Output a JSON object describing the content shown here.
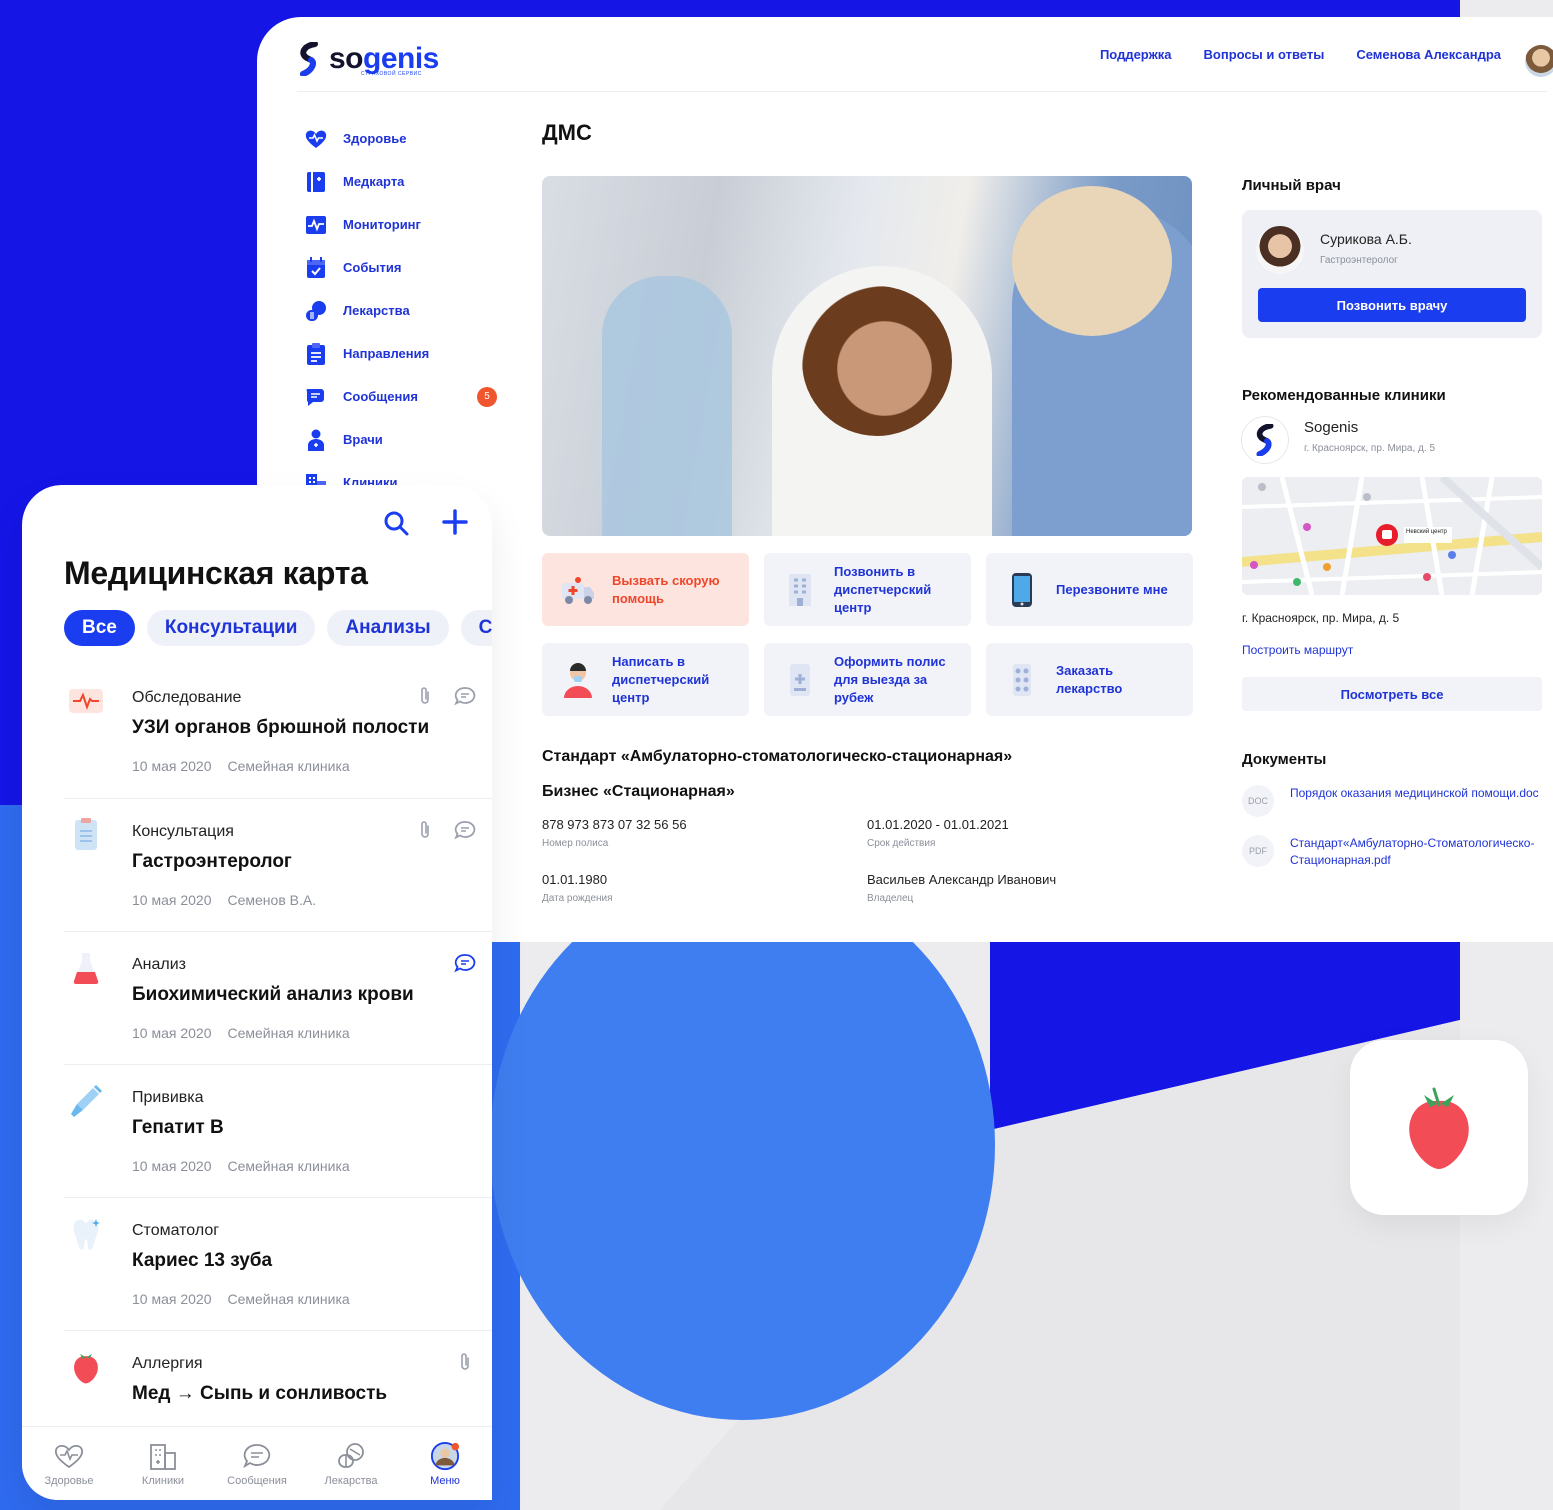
{
  "colors": {
    "brand_blue": "#1a3df0",
    "link_blue": "#1f33d6",
    "alert_red": "#f0462a",
    "bg_blue": "#1515e6",
    "circle_blue": "#3f7ef0"
  },
  "desktop": {
    "logo": {
      "text_a": "so",
      "text_b": "genis",
      "subtitle": "СТРАХОВОЙ СЕРВИС"
    },
    "topnav": {
      "support": "Поддержка",
      "faq": "Вопросы и ответы",
      "user_name": "Семенова Александра"
    },
    "sidebar": [
      {
        "label": "Здоровье",
        "icon": "heart-icon"
      },
      {
        "label": "Медкарта",
        "icon": "medcard-icon"
      },
      {
        "label": "Мониторинг",
        "icon": "monitoring-icon"
      },
      {
        "label": "События",
        "icon": "calendar-icon"
      },
      {
        "label": "Лекарства",
        "icon": "pills-icon"
      },
      {
        "label": "Направления",
        "icon": "clipboard-icon"
      },
      {
        "label": "Сообщения",
        "icon": "chat-icon",
        "badge": "5"
      },
      {
        "label": "Врачи",
        "icon": "doctor-icon"
      },
      {
        "label": "Клиники",
        "icon": "clinic-icon"
      }
    ],
    "main": {
      "title": "ДМС",
      "actions": [
        {
          "label": "Вызвать скорую помощь",
          "icon": "ambulance-icon"
        },
        {
          "label": "Позвонить в диспетчерский центр",
          "icon": "building-icon"
        },
        {
          "label": "Перезвоните мне",
          "icon": "phone-icon"
        },
        {
          "label": "Написать в диспетчерский центр",
          "icon": "operator-icon"
        },
        {
          "label": "Оформить полис для выезда за рубеж",
          "icon": "passport-icon"
        },
        {
          "label": "Заказать лекарство",
          "icon": "medicine-icon"
        }
      ],
      "policy": {
        "title": "Стандарт «Амбулаторно-стоматологическо-стационарная»",
        "subtitle": "Бизнес «Стационарная»",
        "number": "878 973 873 07 32 56 56",
        "number_label": "Номер полиса",
        "period": "01.01.2020 - 01.01.2021",
        "period_label": "Срок действия",
        "birth": "01.01.1980",
        "birth_label": "Дата рождения",
        "owner": "Васильев Александр Иванович",
        "owner_label": "Владелец"
      }
    },
    "right": {
      "doctor_head": "Личный врач",
      "doctor_name": "Сурикова А.Б.",
      "doctor_spec": "Гастроэнтеролог",
      "call_btn": "Позвонить врачу",
      "clinics_head": "Рекомендованные клиники",
      "clinic_name": "Sogenis",
      "clinic_addr": "г. Красноярск, пр. Мира, д. 5",
      "map_pin_label": "Невский центр",
      "route_addr": "г. Красноярск, пр. Мира, д. 5",
      "route_link": "Построить маршрут",
      "see_all": "Посмотреть все",
      "docs_head": "Документы",
      "docs": [
        {
          "badge": "DOC",
          "name": "Порядок оказания медицинской помощи.doc"
        },
        {
          "badge": "PDF",
          "name": "Стандарт«Амбулаторно-Стоматологическо-Стационарная.pdf"
        }
      ]
    }
  },
  "mobile": {
    "title": "Медицинская карта",
    "tabs": [
      {
        "label": "Все",
        "active": true
      },
      {
        "label": "Консультации"
      },
      {
        "label": "Анализы"
      },
      {
        "label": "С"
      }
    ],
    "records": [
      {
        "type": "Обследование",
        "name": "УЗИ органов брюшной полости",
        "date": "10 мая 2020",
        "place": "Семейная клиника",
        "icon": "ecg-icon",
        "attach": true,
        "comment": true
      },
      {
        "type": "Консультация",
        "name": "Гастроэнтеролог",
        "date": "10 мая 2020",
        "place": "Семенов В.А.",
        "icon": "document-icon",
        "attach": true,
        "comment": true
      },
      {
        "type": "Анализ",
        "name": "Биохимический анализ крови",
        "date": "10 мая 2020",
        "place": "Семейная клиника",
        "icon": "flask-icon",
        "attach": false,
        "comment": true
      },
      {
        "type": "Прививка",
        "name": "Гепатит В",
        "date": "10 мая 2020",
        "place": "Семейная клиника",
        "icon": "syringe-icon",
        "attach": false,
        "comment": false
      },
      {
        "type": "Стоматолог",
        "name": "Кариес 13 зуба",
        "date": "10 мая 2020",
        "place": "Семейная клиника",
        "icon": "tooth-icon",
        "attach": false,
        "comment": false
      },
      {
        "type": "Аллергия",
        "name_a": "Мед",
        "name_b": "Сыпь и сонливость",
        "icon": "strawberry-icon",
        "attach": true,
        "comment": false
      }
    ],
    "bottom_nav": [
      {
        "label": "Здоровье",
        "icon": "heart-outline-icon"
      },
      {
        "label": "Клиники",
        "icon": "clinic-outline-icon"
      },
      {
        "label": "Сообщения",
        "icon": "chat-outline-icon"
      },
      {
        "label": "Лекарства",
        "icon": "pills-outline-icon"
      },
      {
        "label": "Меню",
        "icon": "menu-avatar-icon",
        "active": true
      }
    ]
  }
}
